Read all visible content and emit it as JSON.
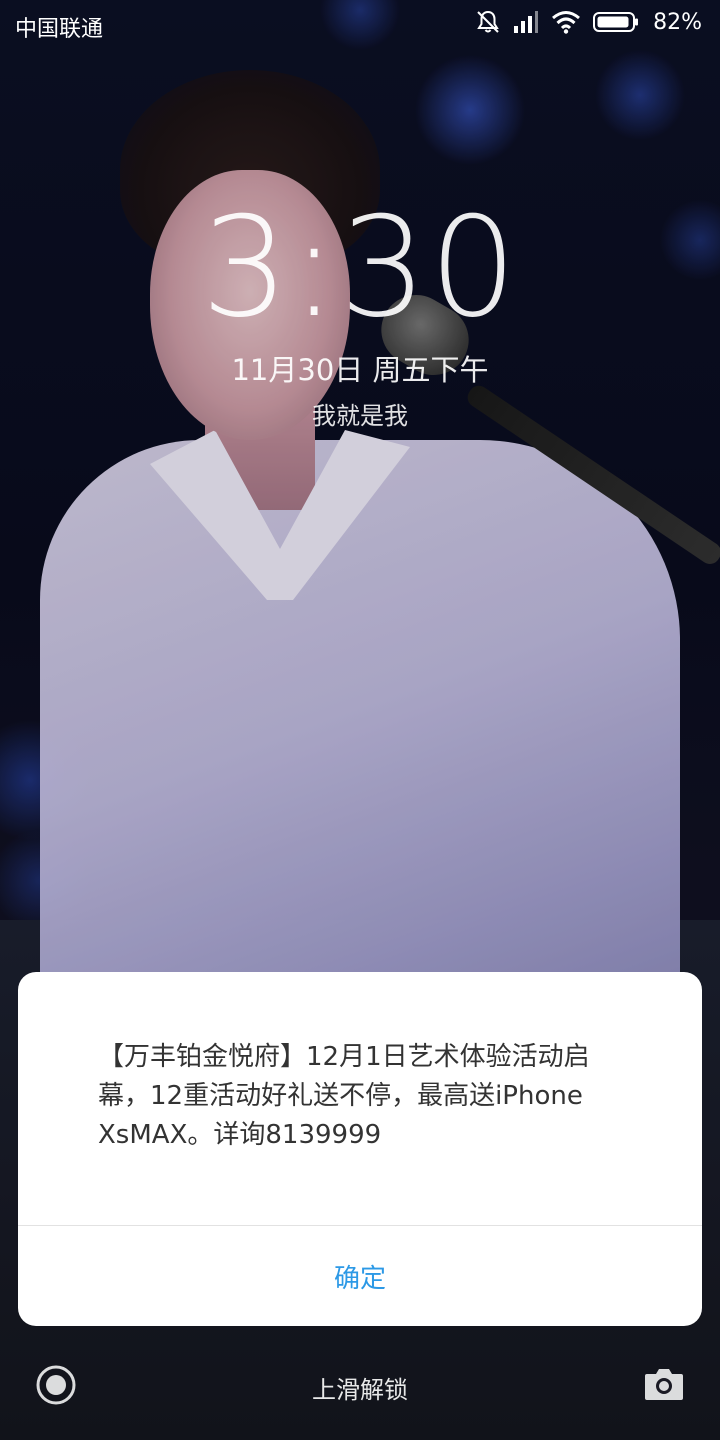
{
  "status_bar": {
    "carrier": "中国联通",
    "battery_percent": "82%",
    "icons": [
      "bell-off-icon",
      "signal-icon",
      "wifi-icon",
      "battery-icon"
    ]
  },
  "lockscreen": {
    "time": "3:30",
    "date": "11月30日  周五下午",
    "owner_info": "我就是我",
    "unlock_hint": "上滑解锁",
    "left_shortcut_icon": "record-icon",
    "right_shortcut_icon": "camera-icon"
  },
  "dialog": {
    "message": "【万丰铂金悦府】12月1日艺术体验活动启幕，12重活动好礼送不停，最高送iPhoneXsMAX。详询8139999",
    "ok_label": "确定",
    "accent_color": "#2c99e6"
  }
}
